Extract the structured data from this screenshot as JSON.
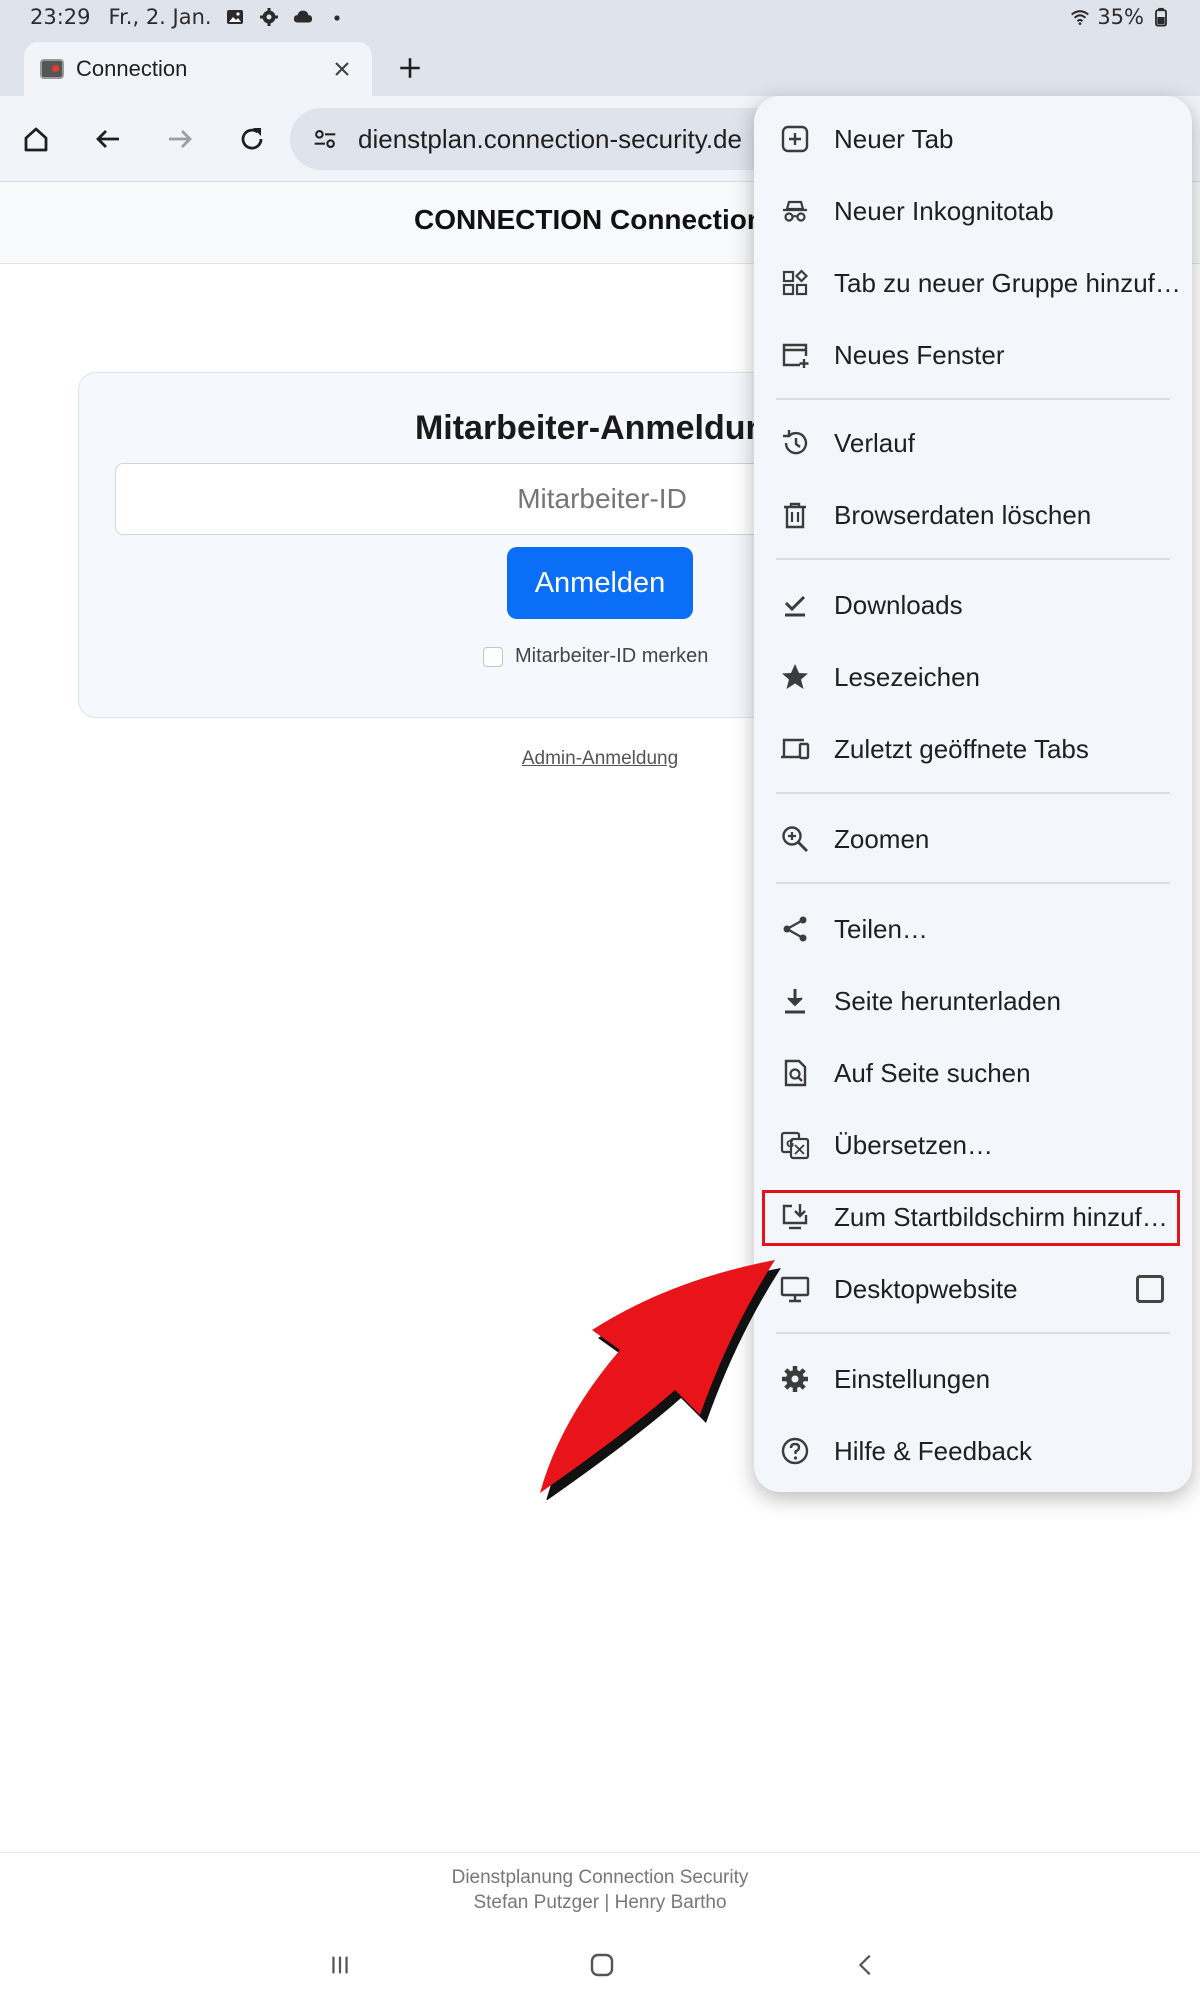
{
  "status_bar": {
    "time": "23:29",
    "date": "Fr., 2. Jan.",
    "battery": "35%"
  },
  "tab": {
    "title": "Connection"
  },
  "omnibox": {
    "url": "dienstplan.connection-security.de"
  },
  "page": {
    "brand": "CONNECTION Connection",
    "login_title": "Mitarbeiter-Anmeldung",
    "id_placeholder": "Mitarbeiter-ID",
    "login_button": "Anmelden",
    "remember_label": "Mitarbeiter-ID merken",
    "admin_link": "Admin-Anmeldung",
    "footer_line1": "Dienstplanung Connection Security",
    "footer_line2": "Stefan Putzger | Henry Bartho"
  },
  "menu": {
    "items": [
      {
        "label": "Neuer Tab",
        "icon": "new-tab-icon"
      },
      {
        "label": "Neuer Inkognitotab",
        "icon": "incognito-icon"
      },
      {
        "label": "Tab zu neuer Gruppe hinzuf…",
        "icon": "tab-group-icon"
      },
      {
        "label": "Neues Fenster",
        "icon": "new-window-icon"
      },
      {
        "label": "Verlauf",
        "icon": "history-icon"
      },
      {
        "label": "Browserdaten löschen",
        "icon": "trash-icon"
      },
      {
        "label": "Downloads",
        "icon": "downloads-check-icon"
      },
      {
        "label": "Lesezeichen",
        "icon": "star-icon"
      },
      {
        "label": "Zuletzt geöffnete Tabs",
        "icon": "devices-icon"
      },
      {
        "label": "Zoomen",
        "icon": "zoom-icon"
      },
      {
        "label": "Teilen…",
        "icon": "share-icon"
      },
      {
        "label": "Seite herunterladen",
        "icon": "download-icon"
      },
      {
        "label": "Auf Seite suchen",
        "icon": "find-in-page-icon"
      },
      {
        "label": "Übersetzen…",
        "icon": "translate-icon"
      },
      {
        "label": "Zum Startbildschirm hinzuf…",
        "icon": "add-to-home-icon"
      },
      {
        "label": "Desktopwebsite",
        "icon": "desktop-icon"
      },
      {
        "label": "Einstellungen",
        "icon": "gear-icon"
      },
      {
        "label": "Hilfe & Feedback",
        "icon": "help-icon"
      }
    ]
  },
  "colors": {
    "highlight": "#e3131b",
    "primary_button": "#0b6ef6",
    "arrow": "#e8141a"
  }
}
